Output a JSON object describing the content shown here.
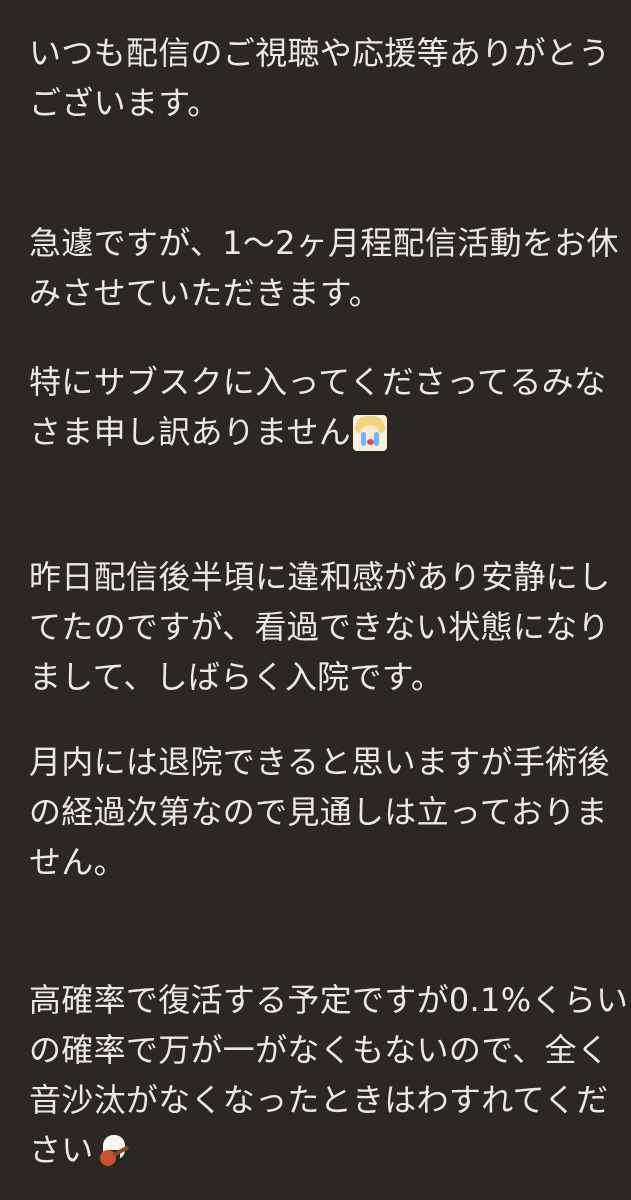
{
  "message": {
    "paragraph_1": {
      "line_1": "いつも配信のご視聴や応援等ありがとう",
      "line_2": "ございます。"
    },
    "paragraph_2": {
      "line_1": "急遽ですが、1〜2ヶ月程配信活動をお休",
      "line_2": "みさせていただきます。"
    },
    "paragraph_3": {
      "line_1": "特にサブスクに入ってくださってるみな",
      "line_2": "さま申し訳ありません"
    },
    "paragraph_4": {
      "line_1": "昨日配信後半頃に違和感があり安静にし",
      "line_2": "てたのですが、看過できない状態になり",
      "line_3": "まして、しばらく入院です。"
    },
    "paragraph_5": {
      "line_1": "月内には退院できると思いますが手術後",
      "line_2": "の経過次第なので見通しは立っておりま",
      "line_3": "せん。"
    },
    "paragraph_6": {
      "line_1": "高確率で復活する予定ですが0.1%くらい",
      "line_2": "の確率で万が一がなくもないので、全く",
      "line_3": "音沙汰がなくなったときはわすれてくだ",
      "line_4": "さい"
    }
  },
  "emojis": {
    "crying_character": "crying-character-emoji",
    "onigiri_guitar": "onigiri-guitar-emoji"
  },
  "colors": {
    "background": "#2b2723",
    "text": "#ece8e3"
  }
}
